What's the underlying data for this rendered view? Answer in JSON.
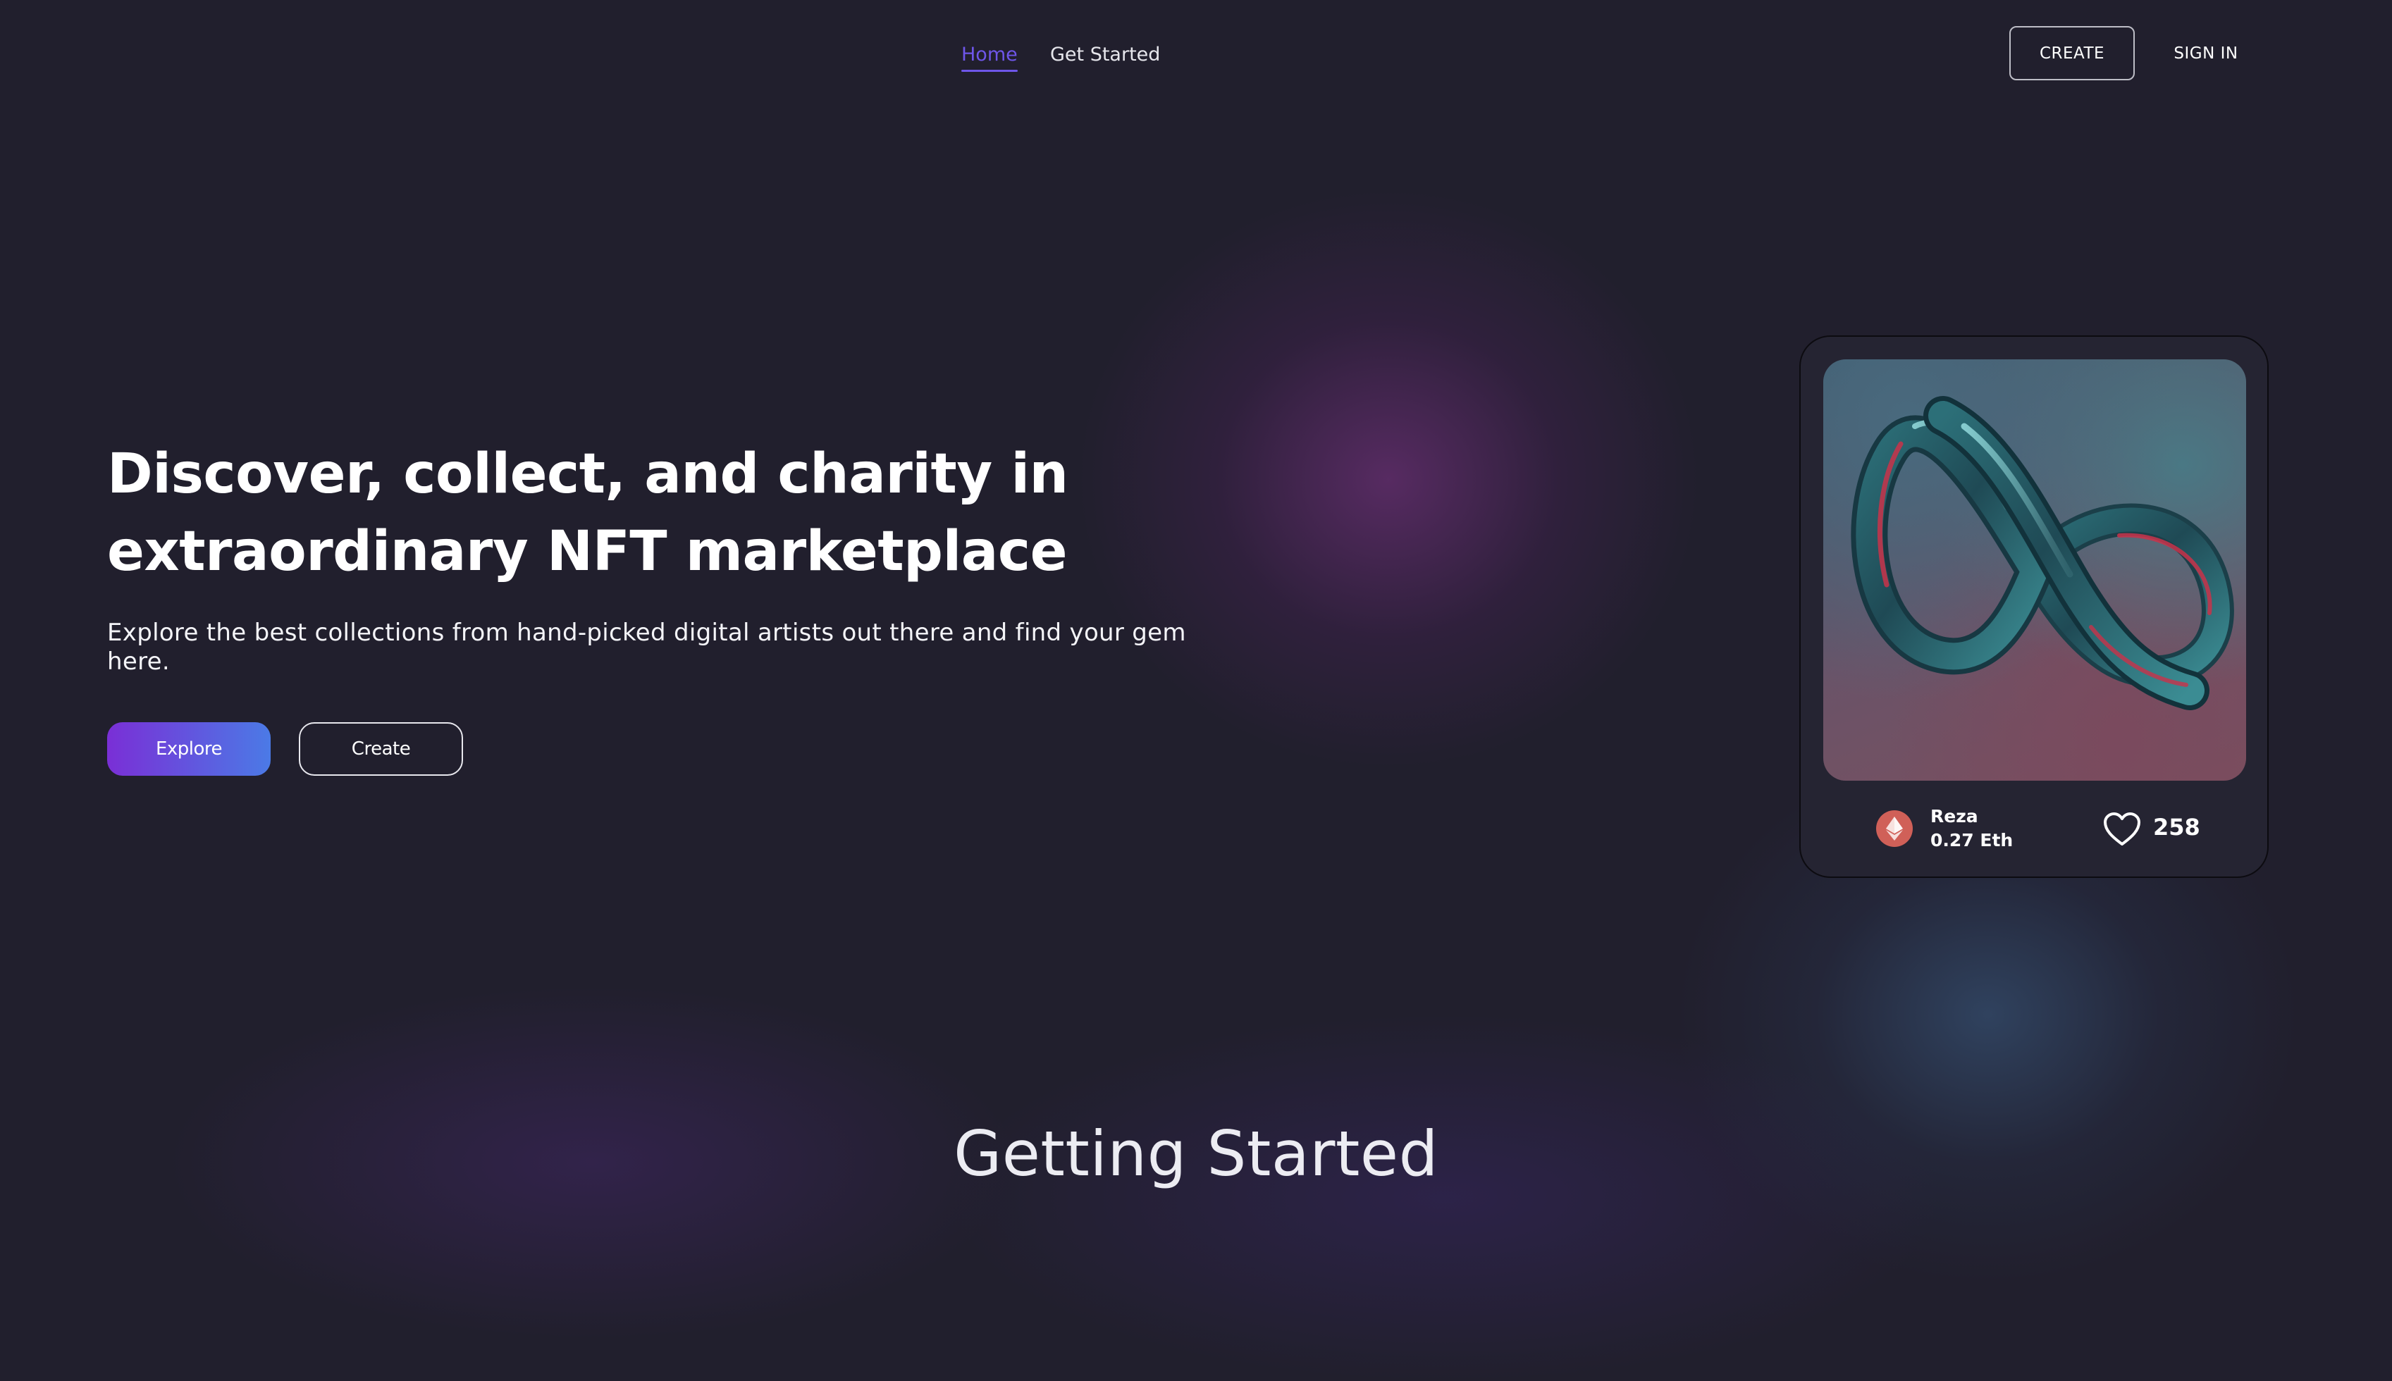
{
  "nav": {
    "links": [
      {
        "label": "Home",
        "active": true
      },
      {
        "label": "Get Started",
        "active": false
      }
    ],
    "create_label": "CREATE",
    "signin_label": "SIGN IN"
  },
  "hero": {
    "title_line1": "Discover, collect, and charity in",
    "title_line2": "extraordinary NFT marketplace",
    "subtitle": "Explore the best collections from hand-picked digital artists out there and find your gem here.",
    "explore_label": "Explore",
    "create_label": "Create"
  },
  "nft_card": {
    "image": "infinity-loop-3d-artwork",
    "owner_name": "Reza",
    "price": "0.27 Eth",
    "currency_icon": "ethereum-icon",
    "like_icon": "heart-icon",
    "likes": "258"
  },
  "section": {
    "title": "Getting Started"
  },
  "colors": {
    "background": "#211f2d",
    "accent": "#6e56e9",
    "explore_gradient_start": "#7a2fd6",
    "explore_gradient_end": "#4b7ae6",
    "eth_badge": "#d06058"
  }
}
